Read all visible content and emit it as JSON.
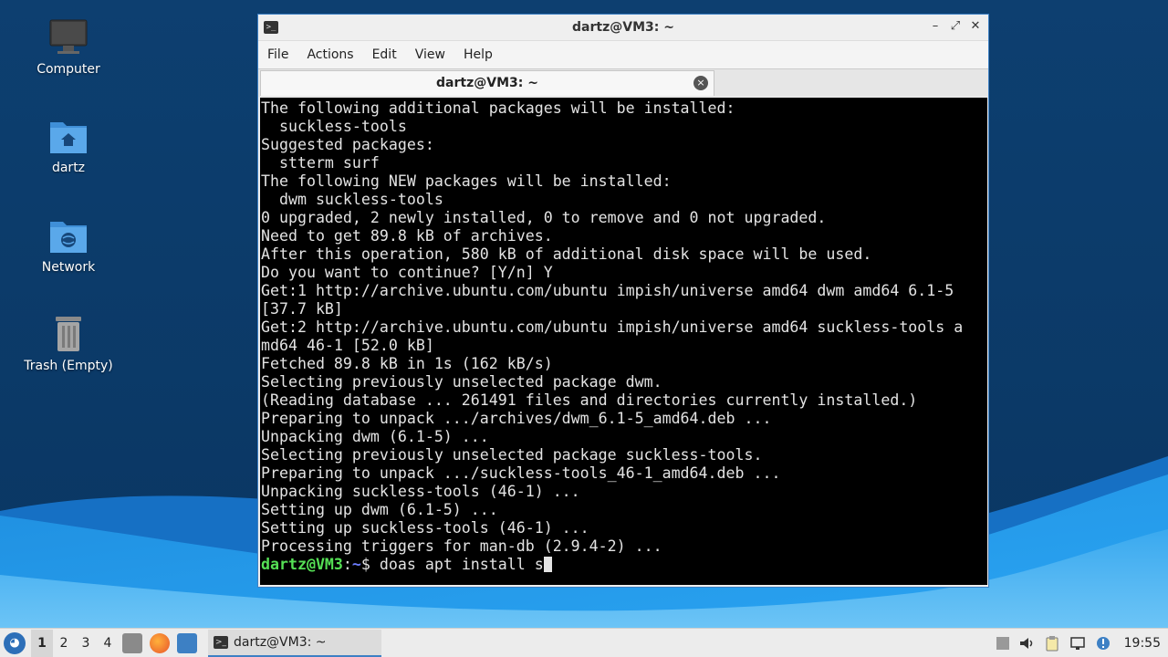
{
  "desktop": {
    "icons": [
      {
        "label": "Computer",
        "icon": "computer-icon"
      },
      {
        "label": "dartz",
        "icon": "home-folder-icon"
      },
      {
        "label": "Network",
        "icon": "network-folder-icon"
      },
      {
        "label": "Trash (Empty)",
        "icon": "trash-icon"
      }
    ]
  },
  "window": {
    "title": "dartz@VM3: ~",
    "controls": [
      "minimize",
      "maximize",
      "close"
    ],
    "menu": [
      "File",
      "Actions",
      "Edit",
      "View",
      "Help"
    ],
    "tab_label": "dartz@VM3: ~",
    "tab_close": "×"
  },
  "terminal": {
    "lines": [
      "The following additional packages will be installed:",
      "  suckless-tools",
      "Suggested packages:",
      "  stterm surf",
      "The following NEW packages will be installed:",
      "  dwm suckless-tools",
      "0 upgraded, 2 newly installed, 0 to remove and 0 not upgraded.",
      "Need to get 89.8 kB of archives.",
      "After this operation, 580 kB of additional disk space will be used.",
      "Do you want to continue? [Y/n] Y",
      "Get:1 http://archive.ubuntu.com/ubuntu impish/universe amd64 dwm amd64 6.1-5",
      "[37.7 kB]",
      "Get:2 http://archive.ubuntu.com/ubuntu impish/universe amd64 suckless-tools a",
      "md64 46-1 [52.0 kB]",
      "Fetched 89.8 kB in 1s (162 kB/s)",
      "Selecting previously unselected package dwm.",
      "(Reading database ... 261491 files and directories currently installed.)",
      "Preparing to unpack .../archives/dwm_6.1-5_amd64.deb ...",
      "Unpacking dwm (6.1-5) ...",
      "Selecting previously unselected package suckless-tools.",
      "Preparing to unpack .../suckless-tools_46-1_amd64.deb ...",
      "Unpacking suckless-tools (46-1) ...",
      "Setting up dwm (6.1-5) ...",
      "Setting up suckless-tools (46-1) ...",
      "Processing triggers for man-db (2.9.4-2) ..."
    ],
    "prompt_user": "dartz@VM3",
    "prompt_sep": ":",
    "prompt_path": "~",
    "prompt_symbol": "$ ",
    "current_input": "doas apt install s"
  },
  "taskbar": {
    "workspaces": [
      "1",
      "2",
      "3",
      "4"
    ],
    "active_workspace": "1",
    "launchers": [
      "file-manager-icon",
      "firefox-icon",
      "desktop-icon"
    ],
    "task_label": "dartz@VM3: ~",
    "tray": [
      "indicator-icon",
      "volume-icon",
      "clipboard-icon",
      "network-icon",
      "notification-icon"
    ],
    "clock": "19:55"
  },
  "colors": {
    "accent": "#3d80c4",
    "prompt_user": "#55e055",
    "prompt_path": "#6c7dff"
  }
}
